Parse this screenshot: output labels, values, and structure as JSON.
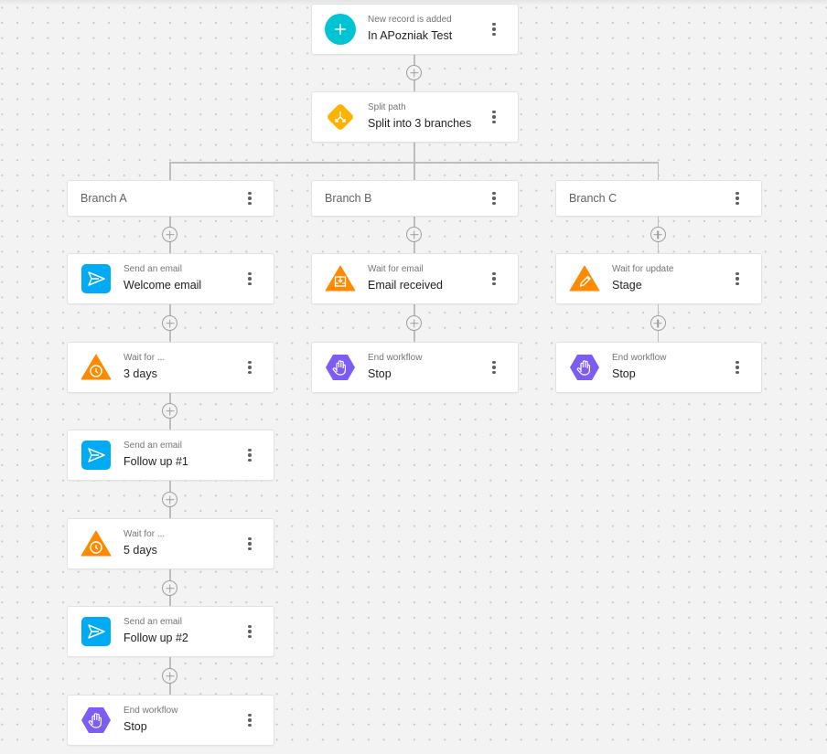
{
  "colors": {
    "trigger": "#00c4d4",
    "split": "#ffb300",
    "email": "#00aaf5",
    "wait": "#ff8a00",
    "end": "#7c5cf5",
    "connector": "#bdbdbd"
  },
  "trigger": {
    "icon": "plus-icon",
    "subtitle": "New record is added",
    "title": "In APozniak Test"
  },
  "split": {
    "icon": "split-icon",
    "subtitle": "Split path",
    "title": "Split into 3 branches"
  },
  "add_step_label": "Add step",
  "branches": [
    {
      "label": "Branch A",
      "steps": [
        {
          "type": "email",
          "icon": "send-icon",
          "subtitle": "Send an email",
          "title": "Welcome email"
        },
        {
          "type": "wait",
          "icon": "clock-icon",
          "subtitle": "Wait for ...",
          "title": "3 days"
        },
        {
          "type": "email",
          "icon": "send-icon",
          "subtitle": "Send an email",
          "title": "Follow up #1"
        },
        {
          "type": "wait",
          "icon": "clock-icon",
          "subtitle": "Wait for ...",
          "title": "5 days"
        },
        {
          "type": "email",
          "icon": "send-icon",
          "subtitle": "Send an email",
          "title": "Follow up #2"
        },
        {
          "type": "end",
          "icon": "hand-stop-icon",
          "subtitle": "End workflow",
          "title": "Stop"
        }
      ]
    },
    {
      "label": "Branch B",
      "steps": [
        {
          "type": "wait-email",
          "icon": "inbox-download-icon",
          "subtitle": "Wait for email",
          "title": "Email received"
        },
        {
          "type": "end",
          "icon": "hand-stop-icon",
          "subtitle": "End workflow",
          "title": "Stop"
        }
      ]
    },
    {
      "label": "Branch C",
      "steps": [
        {
          "type": "wait-update",
          "icon": "pencil-icon",
          "subtitle": "Wait for update",
          "title": "Stage"
        },
        {
          "type": "end",
          "icon": "hand-stop-icon",
          "subtitle": "End workflow",
          "title": "Stop"
        }
      ]
    }
  ]
}
